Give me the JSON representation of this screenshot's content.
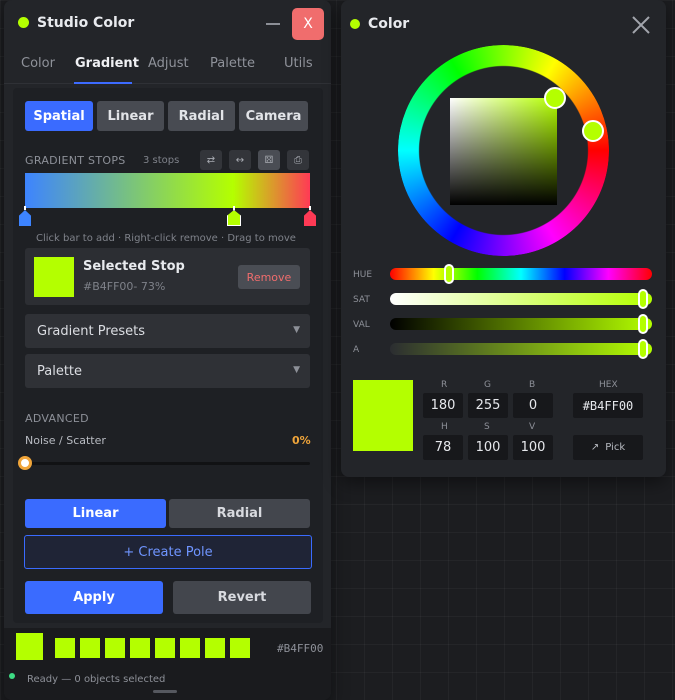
{
  "studio": {
    "title": "Studio Color",
    "close_label": "X",
    "tabs": [
      "Color",
      "Gradient",
      "Adjust",
      "Palette",
      "Utils"
    ],
    "active_tab": "Gradient",
    "modes": [
      "Spatial",
      "Linear",
      "Radial",
      "Camera"
    ],
    "active_mode": "Spatial",
    "stops_title": "GRADIENT STOPS",
    "stops_count": "3 stops",
    "stops": [
      {
        "color": "#3d84ff",
        "position": 0
      },
      {
        "color": "#b4ff00",
        "position": 0.73
      },
      {
        "color": "#ff3a55",
        "position": 1
      }
    ],
    "bar_hint": "Click bar to add · Right-click remove · Drag to move",
    "selected_stop": {
      "title": "Selected Stop",
      "detail": "#B4FF00- 73%",
      "remove_label": "Remove",
      "color": "#b4ff00"
    },
    "presets_label": "Gradient Presets",
    "palette_label": "Palette",
    "advanced_title": "ADVANCED",
    "noise_label": "Noise / Scatter",
    "noise_value": "0%",
    "noise_level": 0,
    "pole_types": [
      "Linear",
      "Radial"
    ],
    "active_pole_type": "Linear",
    "create_pole_label": "+ Create Pole",
    "apply_label": "Apply",
    "revert_label": "Revert",
    "footer_hex": "#B4FF00",
    "status": "Ready — 0 objects selected",
    "accent": "#3a6bff",
    "current_color": "#b4ff00"
  },
  "color_panel": {
    "title": "Color",
    "slider_labels": [
      "HUE",
      "SAT",
      "VAL",
      "A"
    ],
    "rgb_labels": [
      "R",
      "G",
      "B"
    ],
    "rgb_values": [
      "180",
      "255",
      "0"
    ],
    "hsv_labels": [
      "H",
      "S",
      "V"
    ],
    "hsv_values": [
      "78",
      "100",
      "100"
    ],
    "hex_label": "HEX",
    "hex_value": "#B4FF00",
    "pick_label": "Pick",
    "hue": 78,
    "sat": 1,
    "val": 1,
    "alpha": 1
  }
}
